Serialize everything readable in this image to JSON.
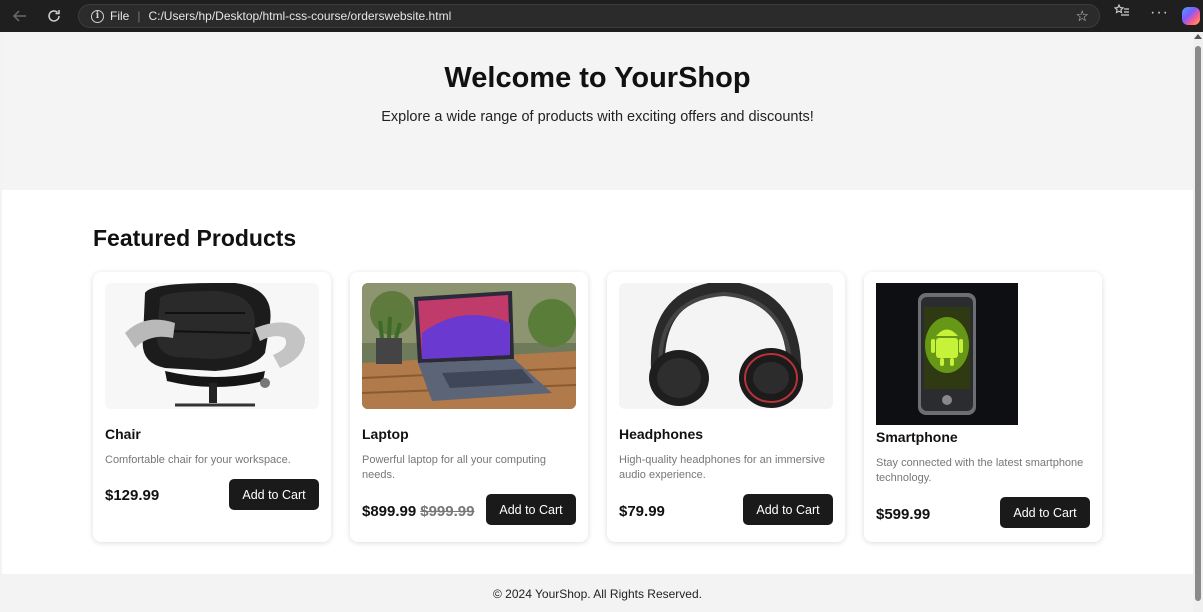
{
  "browser": {
    "protocol_label": "File",
    "url": "C:/Users/hp/Desktop/html-css-course/orderswebsite.html",
    "icons": [
      "back-arrow-icon",
      "reload-icon",
      "info-icon",
      "star-icon",
      "favorites-icon",
      "more-icon",
      "copilot-icon"
    ]
  },
  "hero": {
    "title": "Welcome to YourShop",
    "subtitle": "Explore a wide range of products with exciting offers and discounts!"
  },
  "featured": {
    "title": "Featured Products",
    "products": [
      {
        "name": "Chair",
        "description": "Comfortable chair for your workspace.",
        "price": "$129.99",
        "old_price": "",
        "button": "Add to Cart",
        "image": "office-chair"
      },
      {
        "name": "Laptop",
        "description": "Powerful laptop for all your computing needs.",
        "price": "$899.99",
        "old_price": "$999.99",
        "button": "Add to Cart",
        "image": "laptop-on-table"
      },
      {
        "name": "Headphones",
        "description": "High-quality headphones for an immersive audio experience.",
        "price": "$79.99",
        "old_price": "",
        "button": "Add to Cart",
        "image": "headphones"
      },
      {
        "name": "Smartphone",
        "description": "Stay connected with the latest smartphone technology.",
        "price": "$599.99",
        "old_price": "",
        "button": "Add to Cart",
        "image": "android-phone"
      }
    ]
  },
  "footer": {
    "text": "© 2024 YourShop. All Rights Reserved."
  },
  "colors": {
    "chrome": "#1f1f1f",
    "button": "#1a1a1a",
    "hero_bg": "#f4f4f4"
  }
}
